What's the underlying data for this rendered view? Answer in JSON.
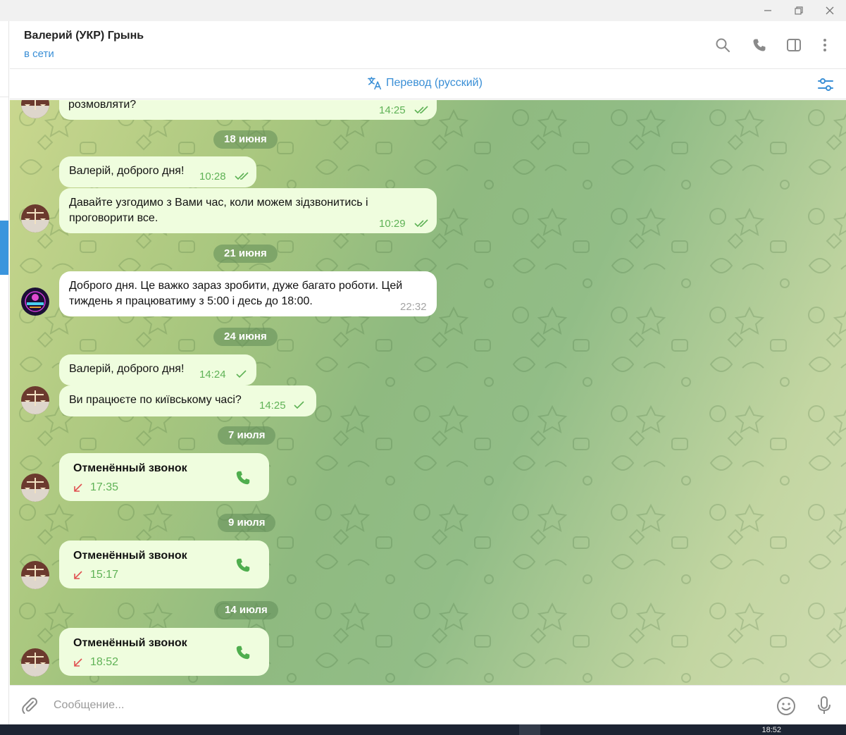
{
  "window": {
    "minimize_icon": "minimize-icon",
    "restore_icon": "restore-icon",
    "close_icon": "close-icon"
  },
  "header": {
    "title": "Валерий (УКР) Грынь",
    "status": "в сети",
    "icons": [
      "search-icon",
      "phone-icon",
      "sidebar-toggle-icon",
      "more-vertical-icon"
    ]
  },
  "translate": {
    "label": "Перевод (русский)",
    "icon": "translate-icon",
    "settings_icon": "filter-settings-icon"
  },
  "messages": {
    "m0": {
      "text": "розмовляти?",
      "time": "14:25"
    },
    "d1": "18 июня",
    "m1": {
      "text": "Валерій, доброго дня!",
      "time": "10:28"
    },
    "m2": {
      "line1": "Давайте узгодимо з Вами час, коли можем зідзвонитись і",
      "line2": "проговорити все.",
      "time": "10:29"
    },
    "d2": "21 июня",
    "m3": {
      "line1": "Доброго дня. Це важко зараз зробити, дуже багато роботи. Цей",
      "line2": "тиждень я працюватиму з 5:00 і десь до 18:00.",
      "time": "22:32"
    },
    "d3": "24 июня",
    "m4": {
      "text": "Валерій, доброго дня!",
      "time": "14:24"
    },
    "m5": {
      "text": "Ви працюєте по київському часі?",
      "time": "14:25"
    },
    "d4": "7 июля",
    "c1": {
      "title": "Отменённый звонок",
      "time": "17:35"
    },
    "d5": "9 июля",
    "c2": {
      "title": "Отменённый звонок",
      "time": "15:17"
    },
    "d6": "14 июля",
    "c3": {
      "title": "Отменённый звонок",
      "time": "18:52"
    }
  },
  "input": {
    "placeholder": "Сообщение...",
    "attach_icon": "paperclip-icon",
    "emoji_icon": "emoji-icon",
    "mic_icon": "microphone-icon"
  },
  "taskbar": {
    "clock": "18:52"
  },
  "colors": {
    "accent": "#3a8fd6",
    "outgoing_bubble": "#effdde",
    "check": "#5fb256",
    "call_icon": "#4fae4e"
  }
}
